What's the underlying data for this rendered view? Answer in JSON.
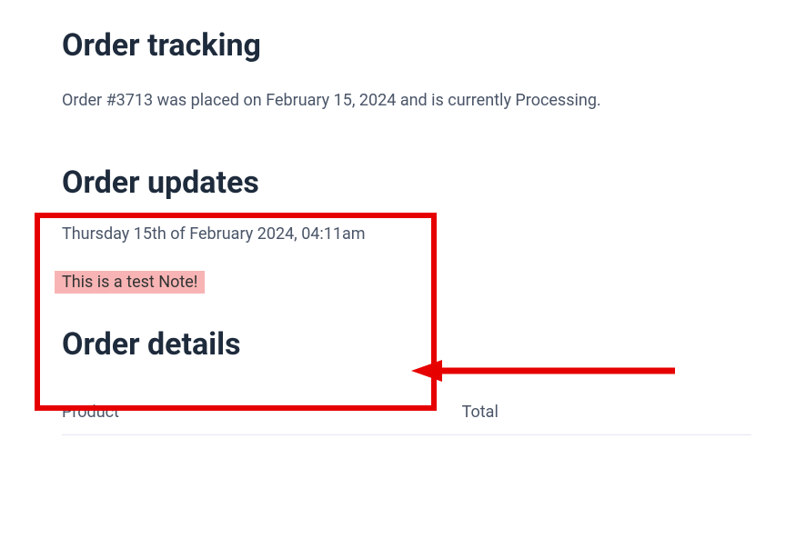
{
  "page_title": "Order tracking",
  "order_status_text": "Order #3713 was placed on February 15, 2024 and is currently Processing.",
  "updates": {
    "heading": "Order updates",
    "timestamp": "Thursday 15th of February 2024, 04:11am",
    "note": "This is a test Note!"
  },
  "details": {
    "heading": "Order details",
    "columns": {
      "product": "Product",
      "total": "Total"
    }
  },
  "annotation": {
    "highlight_color": "#e60000",
    "arrow_color": "#e60000",
    "note_bg": "#f8b4b4"
  }
}
